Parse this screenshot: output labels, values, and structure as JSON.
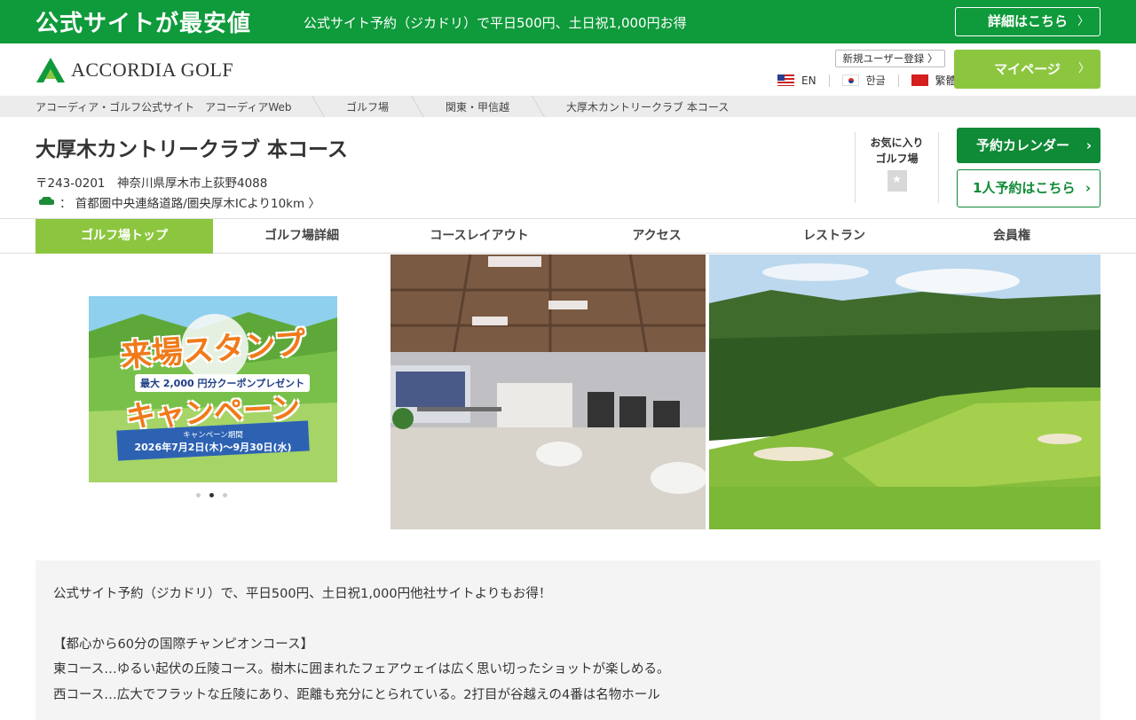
{
  "promo": {
    "title": "公式サイトが最安値",
    "subtitle": "公式サイト予約（ジカドリ）で平日500円、土日祝1,000円お得",
    "button": "詳細はこちら"
  },
  "header": {
    "logo_text": "ACCORDIA GOLF",
    "register": "新規ユーザー登録 〉",
    "mypage": "マイページ",
    "languages": [
      {
        "label": "EN",
        "flag": "us-flag-icon"
      },
      {
        "label": "한글",
        "flag": "kr-flag-icon"
      },
      {
        "label": "繁體",
        "flag": "cn-flag-icon"
      }
    ]
  },
  "breadcrumb": [
    "アコーディア・ゴルフ公式サイト　アコーディアWeb",
    "ゴルフ場",
    "関東・甲信越",
    "大厚木カントリークラブ 本コース"
  ],
  "course": {
    "name": "大厚木カントリークラブ 本コース",
    "address": "〒243-0201　神奈川県厚木市上荻野4088",
    "access": "：  首都圏中央連絡道路/圏央厚木ICより10km 〉",
    "favorite": "お気に入り",
    "favorite_sub": "ゴルフ場",
    "calendar_button": "予約カレンダー",
    "solo_button": "1人予約はこちら"
  },
  "tabs": [
    "ゴルフ場トップ",
    "ゴルフ場詳細",
    "コースレイアウト",
    "アクセス",
    "レストラン",
    "会員権"
  ],
  "banner": {
    "line1": "来場スタンプ",
    "line2": "最大 2,000 円分クーポンプレゼント",
    "line3": "キャンペーン",
    "period_label": "キャンペーン期間",
    "period": "2026年7月2日(木)～9月30日(水)"
  },
  "description": [
    "公式サイト予約（ジカドリ）で、平日500円、土日祝1,000円他社サイトよりもお得！",
    "",
    "【都心から60分の国際チャンピオンコース】",
    "東コース…ゆるい起伏の丘陵コース。樹木に囲まれたフェアウェイは広く思い切ったショットが楽しめる。",
    "西コース…広大でフラットな丘陵にあり、距離も充分にとられている。2打目が谷越えの4番は名物ホール"
  ],
  "colors": {
    "brand_green": "#0f9a3b",
    "accent_lime": "#8cc63f",
    "dark_green": "#0f8a36"
  }
}
